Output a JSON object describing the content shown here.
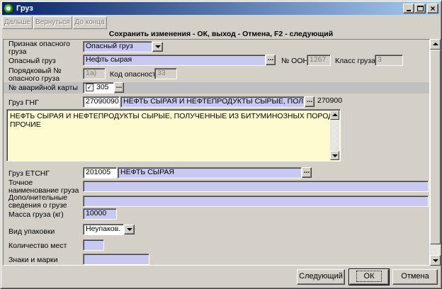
{
  "window": {
    "title": "Груз"
  },
  "toolbar": {
    "next": "Дальше",
    "back": "Вернуться",
    "end": "До конца"
  },
  "hint": "Сохранить изменения - ОК, выход - Отмена, F2 - следующий",
  "form": {
    "hazard_sign": {
      "label": "Признак опасного груза",
      "value": "Опасный груз"
    },
    "hazard_cargo": {
      "label": "Опасный груз",
      "value": "Нефть сырая"
    },
    "oon": {
      "label": "№ ООН",
      "value": "1267"
    },
    "cargo_class": {
      "label": "Класс груза",
      "value": "3"
    },
    "seq_number": {
      "label": "Порядковый № опасного груза (СМГС)",
      "value": "1а)"
    },
    "hazard_code": {
      "label": "Код опасности",
      "value": "33"
    },
    "emergency_card": {
      "label": "№ аварийной карты",
      "value": "305",
      "checked": true
    },
    "gng": {
      "label": "Груз ГНГ",
      "code": "27090090",
      "name": "НЕФТЬ СЫРАЯ И НЕФТЕПРОДУКТЫ СЫРЫЕ, ПОЛУЧЕННЬ",
      "extra": "270900"
    },
    "description": "НЕФТЬ СЫРАЯ И НЕФТЕПРОДУКТЫ СЫРЫЕ, ПОЛУЧЕННЫЕ ИЗ БИТУМИНОЗНЫХ ПОРОД, ПРОЧИЕ",
    "etsng": {
      "label": "Груз ЕТСНГ",
      "code": "201005",
      "name": "НЕФТЬ СЫРАЯ"
    },
    "exact_name": {
      "label": "Точное наименование груза",
      "value": ""
    },
    "additional": {
      "label": "Дополнительные сведения о грузе",
      "value": ""
    },
    "mass": {
      "label": "Масса груза (кг)",
      "value": "10000"
    },
    "packaging": {
      "label": "Вид упаковки",
      "value": "Неупаков."
    },
    "places": {
      "label": "Количество мест",
      "value": ""
    },
    "marks": {
      "label": "Знаки и марки",
      "value": ""
    }
  },
  "buttons": {
    "next": "Следующий",
    "ok": "ОК",
    "cancel": "Отмена"
  },
  "colors": {
    "field_bg": "#c8c8f0",
    "memo_bg": "#fffbd0",
    "title_start": "#0a246a",
    "title_end": "#a6caf0"
  }
}
